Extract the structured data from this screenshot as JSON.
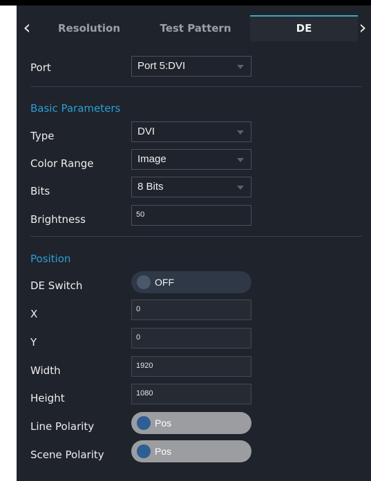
{
  "tabs": {
    "items": [
      {
        "label": "Resolution"
      },
      {
        "label": "Test Pattern"
      },
      {
        "label": "DE"
      }
    ],
    "prev_icon": "chevron-left-icon",
    "next_icon": "chevron-right-icon",
    "prev_glyph": "‹",
    "next_glyph": "›"
  },
  "port": {
    "label": "Port",
    "value": "Port 5:DVI"
  },
  "basic": {
    "title": "Basic Parameters",
    "type": {
      "label": "Type",
      "value": "DVI"
    },
    "color_range": {
      "label": "Color Range",
      "value": "Image"
    },
    "bits": {
      "label": "Bits",
      "value": "8 Bits"
    },
    "brightness": {
      "label": "Brightness",
      "value": "50"
    }
  },
  "position": {
    "title": "Position",
    "de_switch": {
      "label": "DE Switch",
      "value": "OFF"
    },
    "x": {
      "label": "X",
      "value": "0"
    },
    "y": {
      "label": "Y",
      "value": "0"
    },
    "width": {
      "label": "Width",
      "value": "1920"
    },
    "height": {
      "label": "Height",
      "value": "1080"
    },
    "line_polarity": {
      "label": "Line Polarity",
      "value": "Pos"
    },
    "scene_polarity": {
      "label": "Scene Polarity",
      "value": "Pos"
    }
  },
  "colors": {
    "panel_bg": "#1f232b",
    "accent": "#3fa7c4",
    "section_title": "#2d9ed6",
    "toggle_on_track": "#9b9da0",
    "toggle_off_track": "#2e3847"
  }
}
